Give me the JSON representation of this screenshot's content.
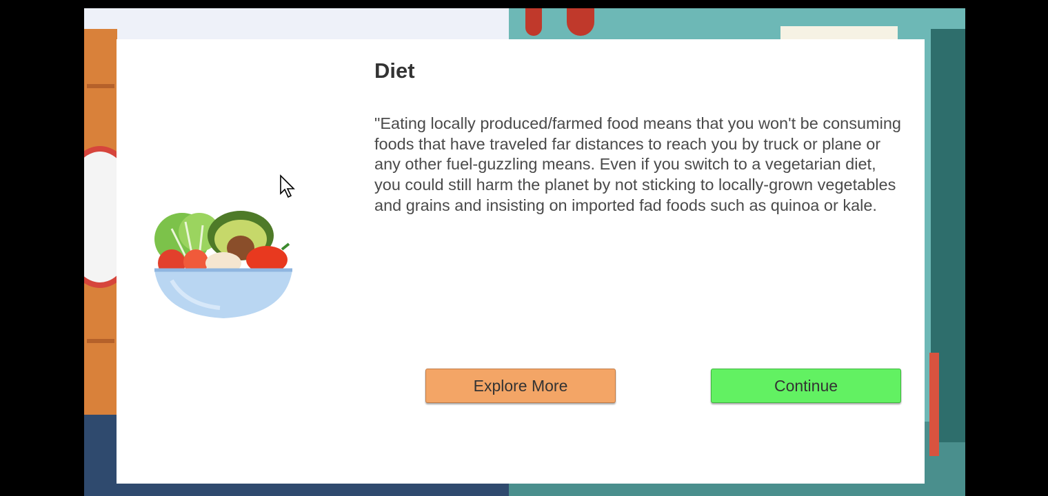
{
  "dialog": {
    "title": "Diet",
    "body": "\"Eating locally produced/farmed food means that you won't be consuming foods that have traveled far distances to reach you by truck or plane or any other fuel-guzzling means. Even if you switch to a vegetarian diet, you could still harm the planet by not sticking to locally-grown vegetables and grains and insisting on imported fad foods such as quinoa or kale.",
    "image_icon": "salad-bowl-icon"
  },
  "buttons": {
    "explore_label": "Explore More",
    "continue_label": "Continue"
  },
  "colors": {
    "explore_button": "#f3a566",
    "continue_button": "#62f162",
    "dialog_background": "#ffffff",
    "scene_teal": "#6db8b6"
  },
  "cursor_icon": "mouse-pointer-icon"
}
